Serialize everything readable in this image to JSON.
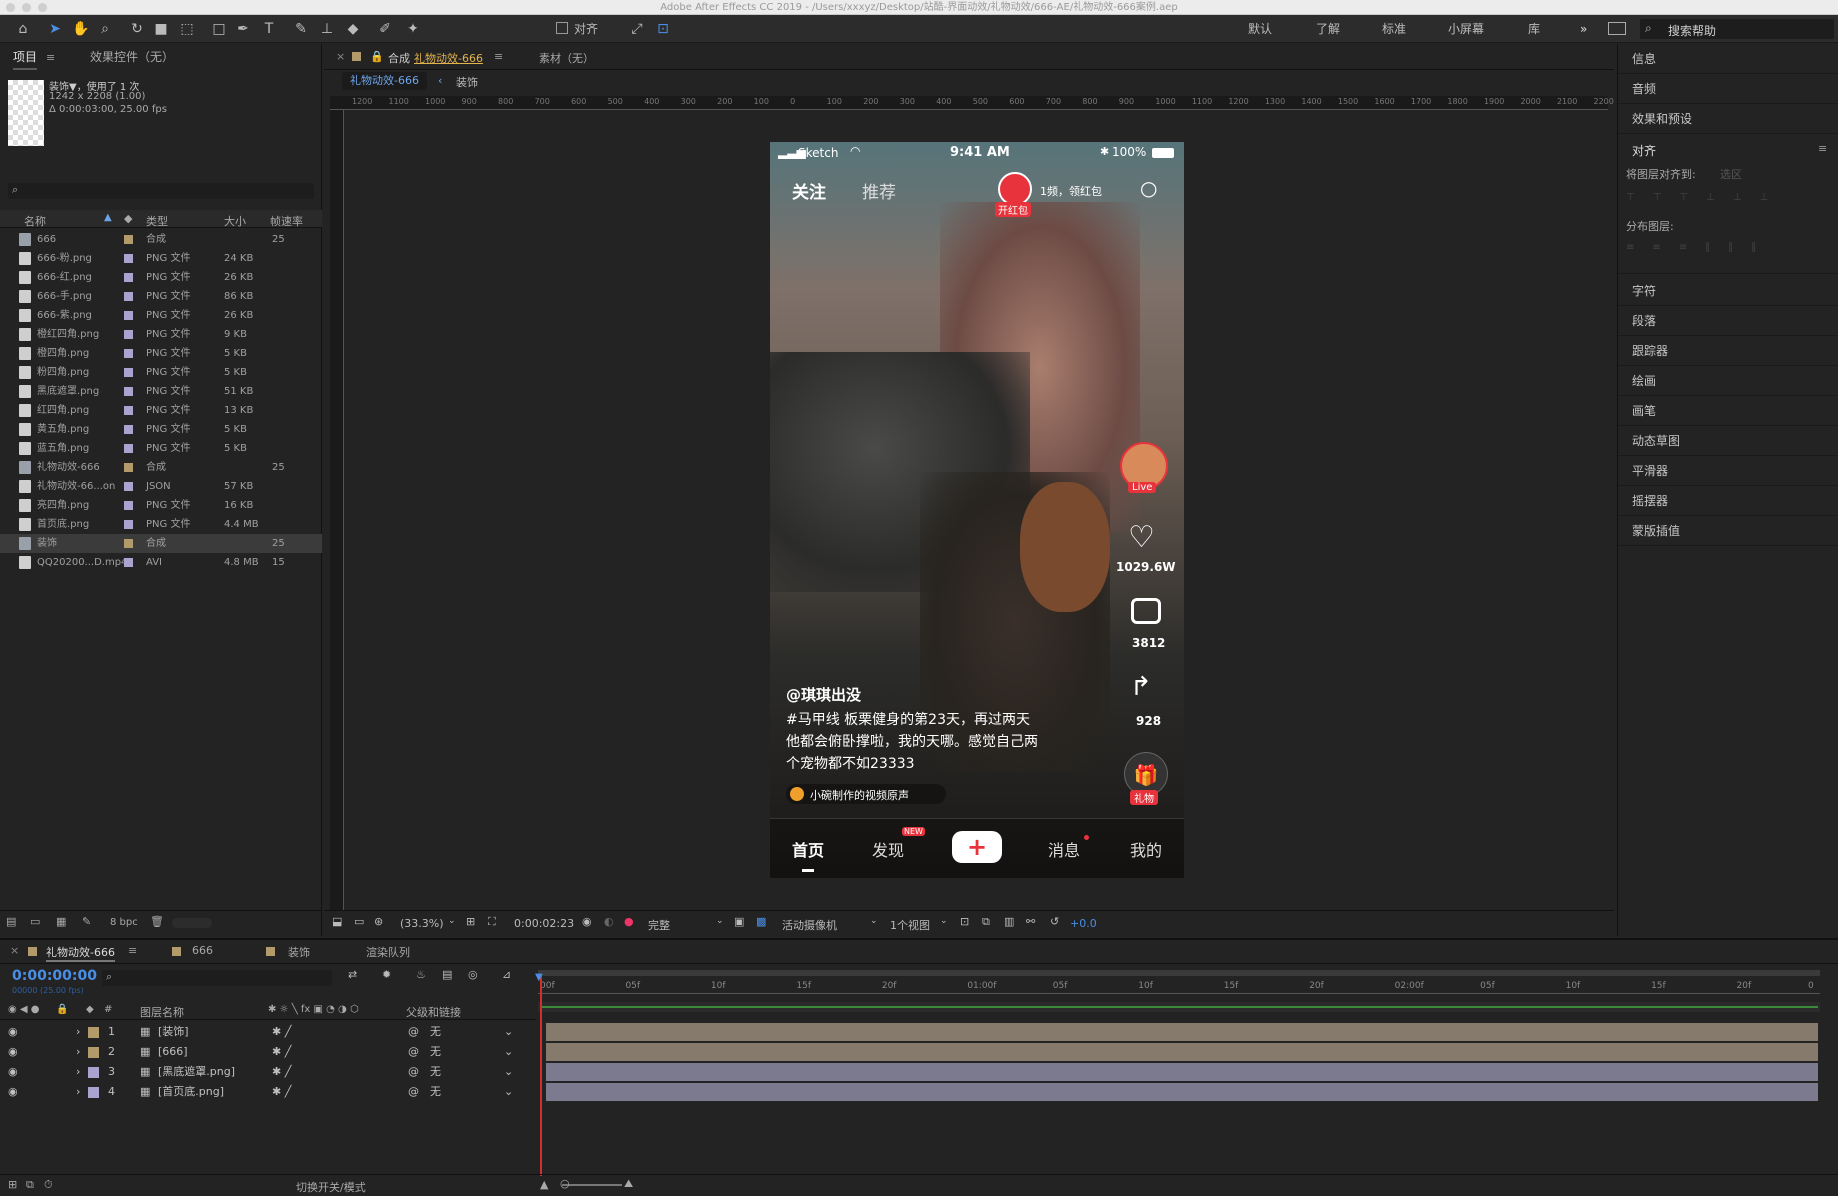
{
  "window": {
    "title": "Adobe After Effects CC 2019 - /Users/xxxyz/Desktop/站酷-界面动效/礼物动效/666-AE/礼物动效-666案例.aep"
  },
  "toolbar": {
    "align_label": "对齐",
    "workspaces": [
      "默认",
      "了解",
      "标准",
      "小屏幕",
      "库"
    ],
    "search_placeholder": "搜索帮助"
  },
  "project_panel": {
    "tab_project": "项目",
    "tab_effects": "效果控件（无）",
    "selected_name": "装饰▼，使用了 1 次",
    "selected_dims": "1242 x 2208 (1.00)",
    "selected_duration": "Δ 0:00:03:00, 25.00 fps",
    "columns": [
      "名称",
      "类型",
      "大小",
      "帧速率"
    ],
    "bpc": "8 bpc",
    "items": [
      {
        "name": "666",
        "type": "合成",
        "size": "",
        "fps": "25",
        "kind": "comp",
        "color": "#b39a6a"
      },
      {
        "name": "666-粉.png",
        "type": "PNG 文件",
        "size": "24 KB",
        "fps": "",
        "kind": "file",
        "color": "#a9a3cf"
      },
      {
        "name": "666-红.png",
        "type": "PNG 文件",
        "size": "26 KB",
        "fps": "",
        "kind": "file",
        "color": "#a9a3cf"
      },
      {
        "name": "666-手.png",
        "type": "PNG 文件",
        "size": "86 KB",
        "fps": "",
        "kind": "file",
        "color": "#a9a3cf"
      },
      {
        "name": "666-紫.png",
        "type": "PNG 文件",
        "size": "26 KB",
        "fps": "",
        "kind": "file",
        "color": "#a9a3cf"
      },
      {
        "name": "橙红四角.png",
        "type": "PNG 文件",
        "size": "9 KB",
        "fps": "",
        "kind": "file",
        "color": "#a9a3cf"
      },
      {
        "name": "橙四角.png",
        "type": "PNG 文件",
        "size": "5 KB",
        "fps": "",
        "kind": "file",
        "color": "#a9a3cf"
      },
      {
        "name": "粉四角.png",
        "type": "PNG 文件",
        "size": "5 KB",
        "fps": "",
        "kind": "file",
        "color": "#a9a3cf"
      },
      {
        "name": "黑底遮罩.png",
        "type": "PNG 文件",
        "size": "51 KB",
        "fps": "",
        "kind": "file",
        "color": "#a9a3cf"
      },
      {
        "name": "红四角.png",
        "type": "PNG 文件",
        "size": "13 KB",
        "fps": "",
        "kind": "file",
        "color": "#a9a3cf"
      },
      {
        "name": "黄五角.png",
        "type": "PNG 文件",
        "size": "5 KB",
        "fps": "",
        "kind": "file",
        "color": "#a9a3cf"
      },
      {
        "name": "蓝五角.png",
        "type": "PNG 文件",
        "size": "5 KB",
        "fps": "",
        "kind": "file",
        "color": "#a9a3cf"
      },
      {
        "name": "礼物动效-666",
        "type": "合成",
        "size": "",
        "fps": "25",
        "kind": "comp",
        "color": "#b39a6a"
      },
      {
        "name": "礼物动效-66...on",
        "type": "JSON",
        "size": "57 KB",
        "fps": "",
        "kind": "file",
        "color": "#a9a3cf"
      },
      {
        "name": "亮四角.png",
        "type": "PNG 文件",
        "size": "16 KB",
        "fps": "",
        "kind": "file",
        "color": "#a9a3cf"
      },
      {
        "name": "首页底.png",
        "type": "PNG 文件",
        "size": "4.4 MB",
        "fps": "",
        "kind": "file",
        "color": "#a9a3cf"
      },
      {
        "name": "装饰",
        "type": "合成",
        "size": "",
        "fps": "25",
        "kind": "comp",
        "color": "#b39a6a"
      },
      {
        "name": "QQ20200...D.mp4",
        "type": "AVI",
        "size": "4.8 MB",
        "fps": "15",
        "kind": "file",
        "color": "#a9a3cf"
      }
    ]
  },
  "viewer": {
    "comp_tab_prefix": "合成",
    "comp_tab_name": "礼物动效-666",
    "footage_tab": "素材（无）",
    "breadcrumb_active": "礼物动效-666",
    "breadcrumb_next": "装饰",
    "ruler_labels": [
      "1200",
      "1100",
      "1000",
      "900",
      "800",
      "700",
      "600",
      "500",
      "400",
      "300",
      "200",
      "100",
      "0",
      "100",
      "200",
      "300",
      "400",
      "500",
      "600",
      "700",
      "800",
      "900",
      "1000",
      "1100",
      "1200",
      "1300",
      "1400",
      "1500",
      "1600",
      "1700",
      "1800",
      "1900",
      "2000",
      "2100",
      "2200"
    ],
    "zoom": "(33.3%)",
    "timecode": "0:00:02:23",
    "resolution": "完整",
    "camera": "活动摄像机",
    "views": "1个视图",
    "exposure": "+0.0"
  },
  "phone": {
    "carrier": "Sketch",
    "time": "9:41 AM",
    "battery": "100%",
    "tab_follow": "关注",
    "tab_recommend": "推荐",
    "redpacket_badge": "开红包",
    "redpacket_text": "1频，领红包",
    "live_label": "Live",
    "likes": "1029.6W",
    "comments": "3812",
    "shares": "928",
    "gift_label": "礼物",
    "username": "@琪琪出没",
    "caption_line1": "#马甲线 板栗健身的第23天，再过两天",
    "caption_line2": "他都会俯卧撑啦，我的天哪。感觉自己两",
    "caption_line3": "个宠物都不如23333",
    "music": "小碗制作的视频原声",
    "nav_home": "首页",
    "nav_discover": "发现",
    "nav_new_badge": "NEW",
    "nav_messages": "消息",
    "nav_me": "我的"
  },
  "right_panel": {
    "items_top": [
      "信息",
      "音频",
      "效果和预设"
    ],
    "align_title": "对齐",
    "align_to_label": "将图层对齐到:",
    "align_to_value": "选区",
    "distribute_label": "分布图层:",
    "items_bottom": [
      "字符",
      "段落",
      "跟踪器",
      "绘画",
      "画笔",
      "动态草图",
      "平滑器",
      "摇摆器",
      "蒙版插值"
    ]
  },
  "timeline": {
    "tabs": [
      "礼物动效-666",
      "666",
      "装饰",
      "渲染队列"
    ],
    "tab_colors": [
      "#b39a6a",
      "#b39a6a",
      "#b39a6a"
    ],
    "current_time": "0:00:00:00",
    "frame_info": "00000 (25.00 fps)",
    "col_layer_name": "图层名称",
    "col_parent": "父级和链接",
    "ruler": [
      "00f",
      "05f",
      "10f",
      "15f",
      "20f",
      "01:00f",
      "05f",
      "10f",
      "15f",
      "20f",
      "02:00f",
      "05f",
      "10f",
      "15f",
      "20f",
      "0"
    ],
    "layers": [
      {
        "num": "1",
        "name": "[装饰]",
        "parent": "无",
        "color": "#b39a6a",
        "bar": "#857a6c"
      },
      {
        "num": "2",
        "name": "[666]",
        "parent": "无",
        "color": "#b39a6a",
        "bar": "#857a6c"
      },
      {
        "num": "3",
        "name": "[黑底遮罩.png]",
        "parent": "无",
        "color": "#a9a3cf",
        "bar": "#7c7a8f"
      },
      {
        "num": "4",
        "name": "[首页底.png]",
        "parent": "无",
        "color": "#a9a3cf",
        "bar": "#7c7a8f"
      }
    ],
    "footer_toggle": "切换开关/模式"
  }
}
